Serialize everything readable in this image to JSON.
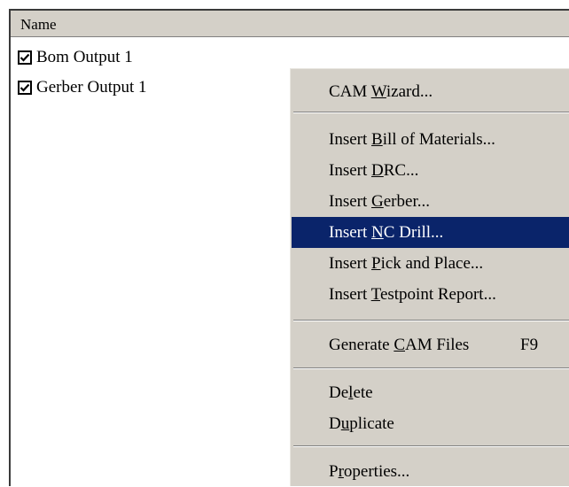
{
  "list": {
    "column_header": "Name",
    "items": [
      {
        "label": "Bom Output 1",
        "checked": true
      },
      {
        "label": "Gerber Output 1",
        "checked": true
      }
    ]
  },
  "context_menu": {
    "highlight_color": "#0a246a",
    "items": [
      {
        "label": "CAM Wizard...",
        "mnemonic": "W"
      },
      {
        "label": "Insert Bill of Materials...",
        "mnemonic": "B"
      },
      {
        "label": "Insert DRC...",
        "mnemonic": "D"
      },
      {
        "label": "Insert Gerber...",
        "mnemonic": "G"
      },
      {
        "label": "Insert NC Drill...",
        "mnemonic": "N",
        "highlighted": true
      },
      {
        "label": "Insert Pick and Place...",
        "mnemonic": "P"
      },
      {
        "label": "Insert Testpoint Report...",
        "mnemonic": "T"
      },
      {
        "label": "Generate CAM Files",
        "mnemonic": "C",
        "shortcut": "F9"
      },
      {
        "label": "Delete",
        "mnemonic": "l"
      },
      {
        "label": "Duplicate",
        "mnemonic": "u"
      },
      {
        "label": "Properties...",
        "mnemonic": "r"
      }
    ]
  }
}
